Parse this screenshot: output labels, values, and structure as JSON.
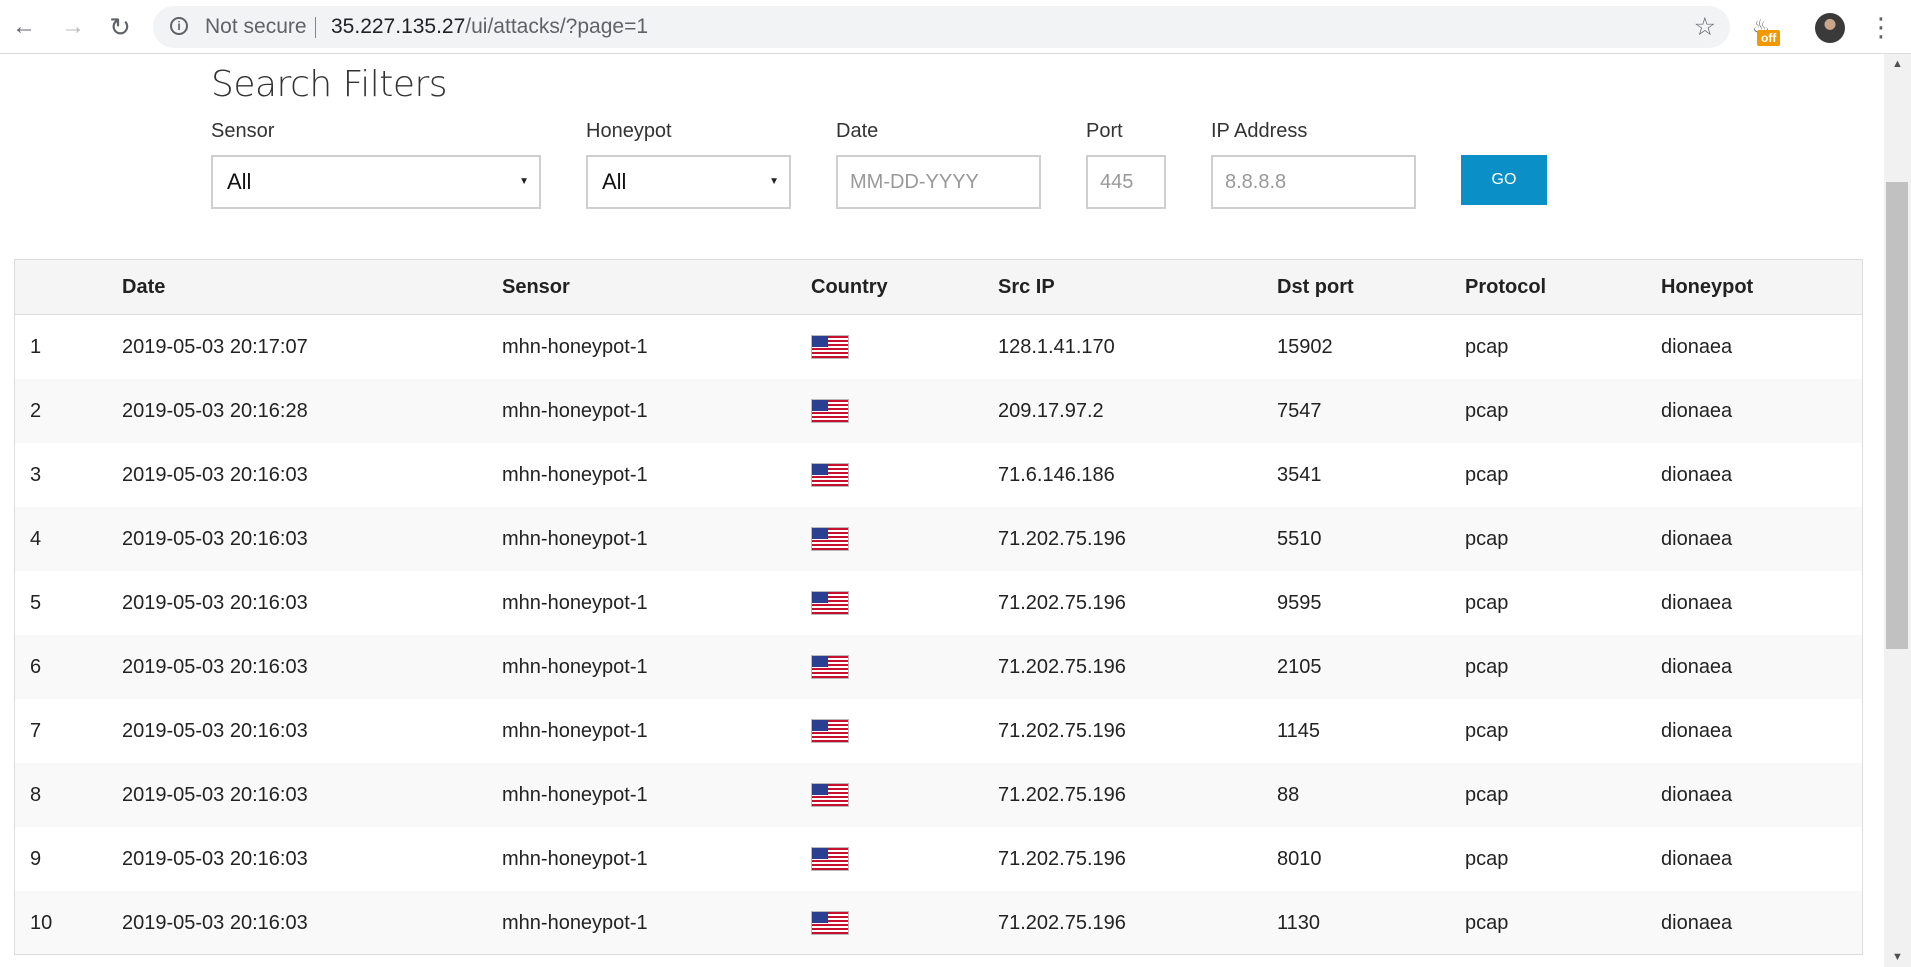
{
  "browser": {
    "security_label": "Not secure",
    "url_host": "35.227.135.27",
    "url_path": "/ui/attacks/?page=1",
    "extension_badge": "off",
    "icons": {
      "back": "arrow-left-icon",
      "forward": "arrow-right-icon",
      "reload": "reload-icon",
      "info": "info-icon",
      "bookmark": "star-icon",
      "menu": "kebab-menu-icon"
    }
  },
  "filters": {
    "title": "Search Filters",
    "sensor": {
      "label": "Sensor",
      "value": "All"
    },
    "honeypot": {
      "label": "Honeypot",
      "value": "All"
    },
    "date": {
      "label": "Date",
      "placeholder": "MM-DD-YYYY"
    },
    "port": {
      "label": "Port",
      "placeholder": "445"
    },
    "ip": {
      "label": "IP Address",
      "placeholder": "8.8.8.8"
    },
    "go_label": "GO",
    "go_color": "#0a8fc6"
  },
  "table": {
    "headers": [
      "",
      "Date",
      "Sensor",
      "Country",
      "Src IP",
      "Dst port",
      "Protocol",
      "Honeypot"
    ],
    "rows": [
      {
        "num": "1",
        "date": "2019-05-03 20:17:07",
        "sensor": "mhn-honeypot-1",
        "country": "us-flag-icon",
        "src_ip": "128.1.41.170",
        "dst_port": "15902",
        "protocol": "pcap",
        "honeypot": "dionaea"
      },
      {
        "num": "2",
        "date": "2019-05-03 20:16:28",
        "sensor": "mhn-honeypot-1",
        "country": "us-flag-icon",
        "src_ip": "209.17.97.2",
        "dst_port": "7547",
        "protocol": "pcap",
        "honeypot": "dionaea"
      },
      {
        "num": "3",
        "date": "2019-05-03 20:16:03",
        "sensor": "mhn-honeypot-1",
        "country": "us-flag-icon",
        "src_ip": "71.6.146.186",
        "dst_port": "3541",
        "protocol": "pcap",
        "honeypot": "dionaea"
      },
      {
        "num": "4",
        "date": "2019-05-03 20:16:03",
        "sensor": "mhn-honeypot-1",
        "country": "us-flag-icon",
        "src_ip": "71.202.75.196",
        "dst_port": "5510",
        "protocol": "pcap",
        "honeypot": "dionaea"
      },
      {
        "num": "5",
        "date": "2019-05-03 20:16:03",
        "sensor": "mhn-honeypot-1",
        "country": "us-flag-icon",
        "src_ip": "71.202.75.196",
        "dst_port": "9595",
        "protocol": "pcap",
        "honeypot": "dionaea"
      },
      {
        "num": "6",
        "date": "2019-05-03 20:16:03",
        "sensor": "mhn-honeypot-1",
        "country": "us-flag-icon",
        "src_ip": "71.202.75.196",
        "dst_port": "2105",
        "protocol": "pcap",
        "honeypot": "dionaea"
      },
      {
        "num": "7",
        "date": "2019-05-03 20:16:03",
        "sensor": "mhn-honeypot-1",
        "country": "us-flag-icon",
        "src_ip": "71.202.75.196",
        "dst_port": "1145",
        "protocol": "pcap",
        "honeypot": "dionaea"
      },
      {
        "num": "8",
        "date": "2019-05-03 20:16:03",
        "sensor": "mhn-honeypot-1",
        "country": "us-flag-icon",
        "src_ip": "71.202.75.196",
        "dst_port": "88",
        "protocol": "pcap",
        "honeypot": "dionaea"
      },
      {
        "num": "9",
        "date": "2019-05-03 20:16:03",
        "sensor": "mhn-honeypot-1",
        "country": "us-flag-icon",
        "src_ip": "71.202.75.196",
        "dst_port": "8010",
        "protocol": "pcap",
        "honeypot": "dionaea"
      },
      {
        "num": "10",
        "date": "2019-05-03 20:16:03",
        "sensor": "mhn-honeypot-1",
        "country": "us-flag-icon",
        "src_ip": "71.202.75.196",
        "dst_port": "1130",
        "protocol": "pcap",
        "honeypot": "dionaea"
      }
    ]
  }
}
